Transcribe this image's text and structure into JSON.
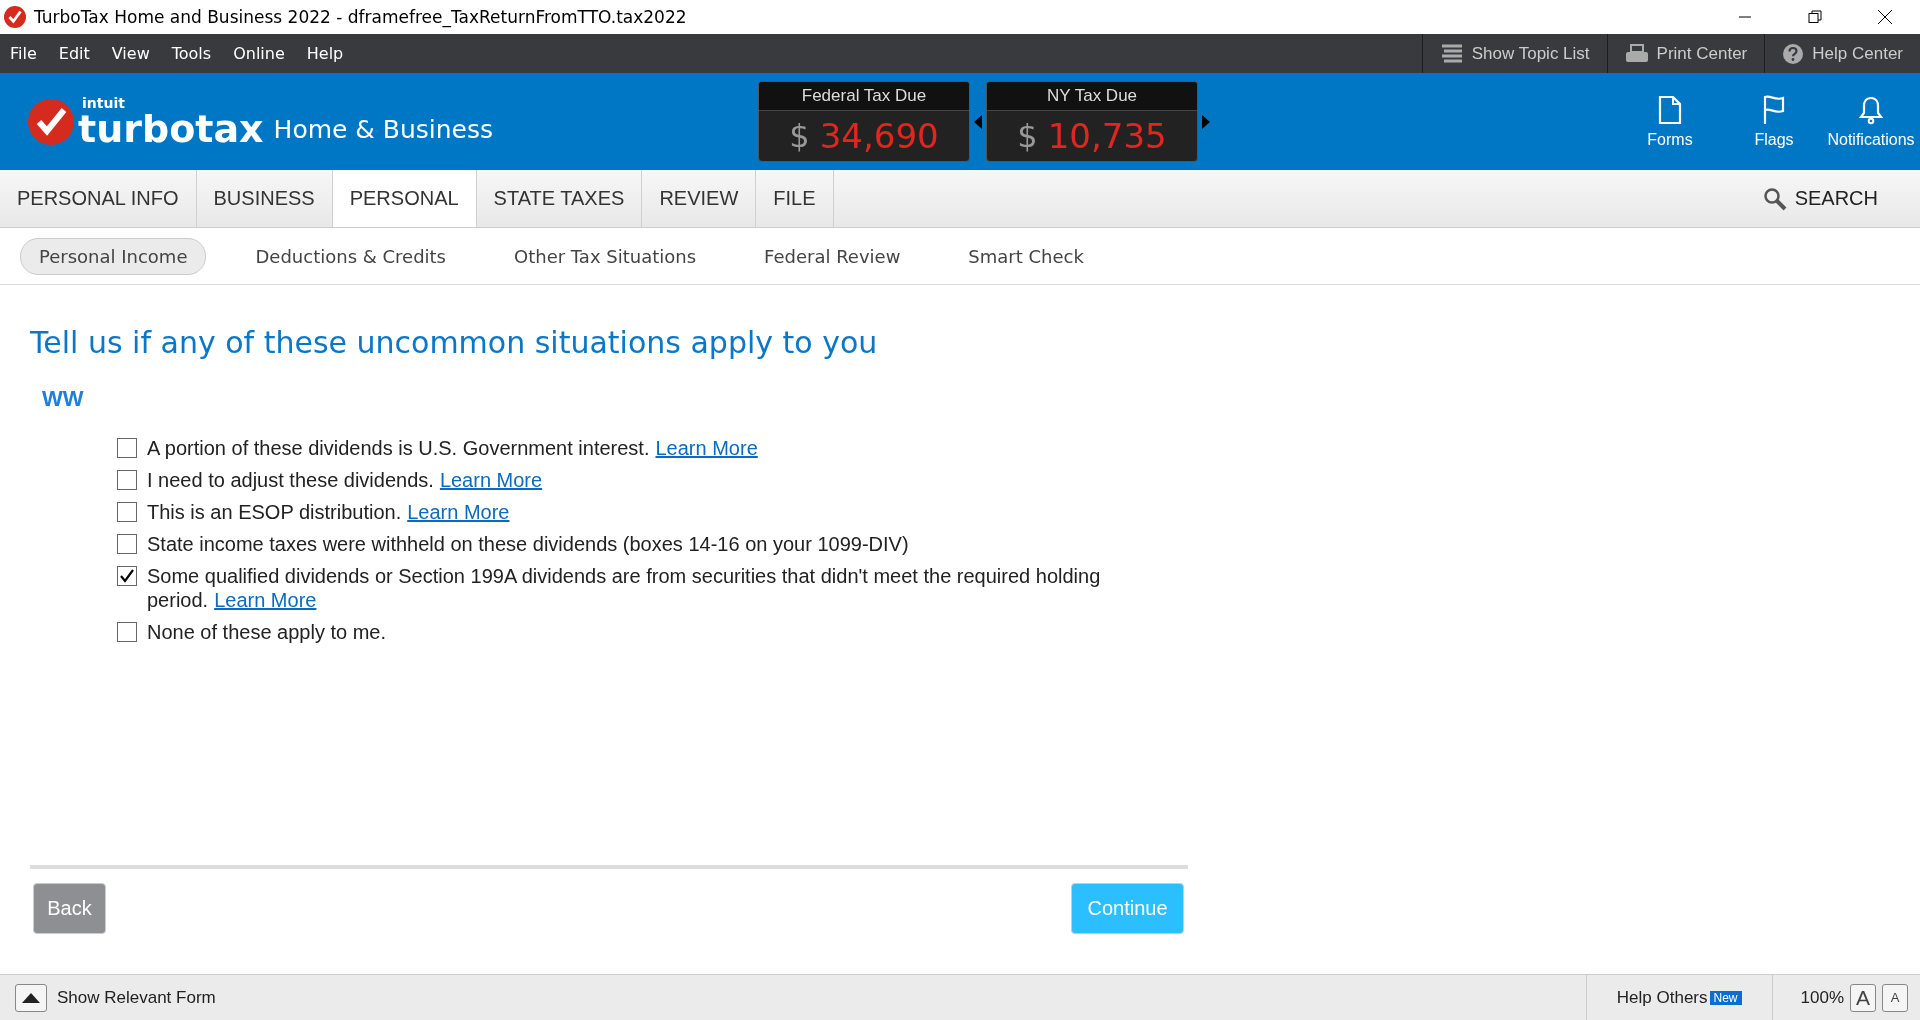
{
  "window": {
    "title": "TurboTax Home and Business 2022 - dframefree_TaxReturnFromTTO.tax2022"
  },
  "menu": [
    "File",
    "Edit",
    "View",
    "Tools",
    "Online",
    "Help"
  ],
  "toolbar": [
    {
      "kind": "topics",
      "label": "Show Topic List"
    },
    {
      "kind": "print",
      "label": "Print Center"
    },
    {
      "kind": "help",
      "label": "Help Center"
    }
  ],
  "brand": {
    "maker": "intuit",
    "name": "turbotax",
    "product": "Home & Business"
  },
  "tax_due": [
    {
      "title": "Federal Tax Due",
      "currency": "$",
      "amount": "34,690"
    },
    {
      "title": "NY Tax Due",
      "currency": "$",
      "amount": "10,735"
    }
  ],
  "header_tools": [
    {
      "kind": "forms",
      "label": "Forms"
    },
    {
      "kind": "flags",
      "label": "Flags"
    },
    {
      "kind": "notifications",
      "label": "Notifications"
    }
  ],
  "tabs": [
    {
      "label": "PERSONAL INFO",
      "selected": false
    },
    {
      "label": "BUSINESS",
      "selected": false
    },
    {
      "label": "PERSONAL",
      "selected": true
    },
    {
      "label": "STATE TAXES",
      "selected": false
    },
    {
      "label": "REVIEW",
      "selected": false
    },
    {
      "label": "FILE",
      "selected": false
    }
  ],
  "search": {
    "label": "SEARCH"
  },
  "subtabs": [
    {
      "label": "Personal Income",
      "selected": true
    },
    {
      "label": "Deductions & Credits",
      "selected": false
    },
    {
      "label": "Other Tax Situations",
      "selected": false
    },
    {
      "label": "Federal Review",
      "selected": false
    },
    {
      "label": "Smart Check",
      "selected": false
    }
  ],
  "heading": "Tell us if any of these uncommon situations apply to you",
  "subheading": "WW",
  "options": [
    {
      "text": "A portion of these dividends is U.S. Government interest.",
      "link": "Learn More",
      "checked": false
    },
    {
      "text": "I need to adjust these dividends.",
      "link": "Learn More",
      "checked": false
    },
    {
      "text": "This is an ESOP distribution.",
      "link": "Learn More",
      "checked": false
    },
    {
      "text": "State income taxes were withheld on these dividends (boxes 14-16 on your 1099-DIV)",
      "checked": false
    },
    {
      "text": "Some qualified dividends or Section 199A dividends are from securities that didn't meet the required holding period.",
      "link": "Learn More",
      "checked": true
    },
    {
      "text": "None of these apply to me.",
      "checked": false
    }
  ],
  "buttons": {
    "back": "Back",
    "continue": "Continue"
  },
  "status_bar": {
    "relevant_form": "Show Relevant Form",
    "help_others": "Help Others",
    "badge": "New",
    "zoom": "100%",
    "font_large": "A",
    "font_small": "A"
  }
}
